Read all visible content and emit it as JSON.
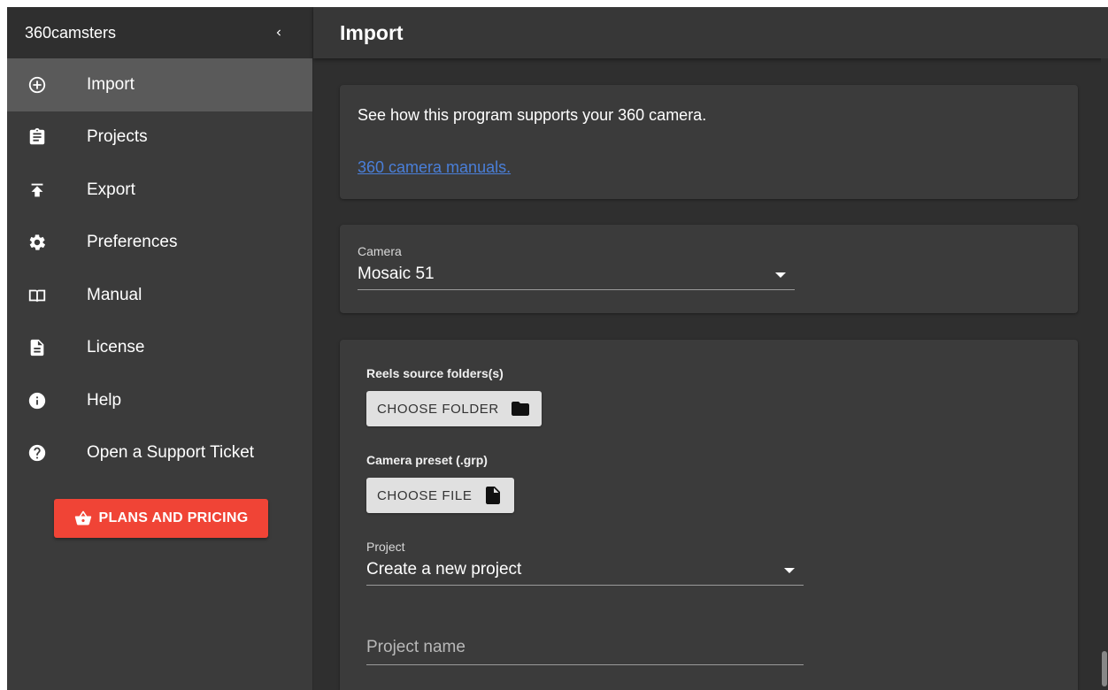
{
  "sidebar": {
    "app_name": "360camsters",
    "items": [
      {
        "label": "Import",
        "icon": "add-circle-icon",
        "active": true
      },
      {
        "label": "Projects",
        "icon": "clipboard-icon"
      },
      {
        "label": "Export",
        "icon": "upload-icon"
      },
      {
        "label": "Preferences",
        "icon": "gear-icon"
      },
      {
        "label": "Manual",
        "icon": "book-icon"
      },
      {
        "label": "License",
        "icon": "document-icon"
      },
      {
        "label": "Help",
        "icon": "info-icon"
      },
      {
        "label": "Open a Support Ticket",
        "icon": "question-icon"
      }
    ],
    "plans_button": "PLANS AND PRICING"
  },
  "topbar": {
    "title": "Import"
  },
  "info_card": {
    "text": "See how this program supports your 360 camera.",
    "link": "360 camera manuals."
  },
  "camera": {
    "label": "Camera",
    "value": "Mosaic 51"
  },
  "form": {
    "reels_label": "Reels source folders(s)",
    "choose_folder": "CHOOSE FOLDER",
    "preset_label": "Camera preset (.grp)",
    "choose_file": "CHOOSE FILE",
    "project_label": "Project",
    "project_value": "Create a new project",
    "project_name_placeholder": "Project name"
  },
  "colors": {
    "accent_red": "#f04436",
    "link_blue": "#4a7fd9",
    "sidebar_bg": "#3b3b3b",
    "main_bg": "#2f2f2f"
  }
}
